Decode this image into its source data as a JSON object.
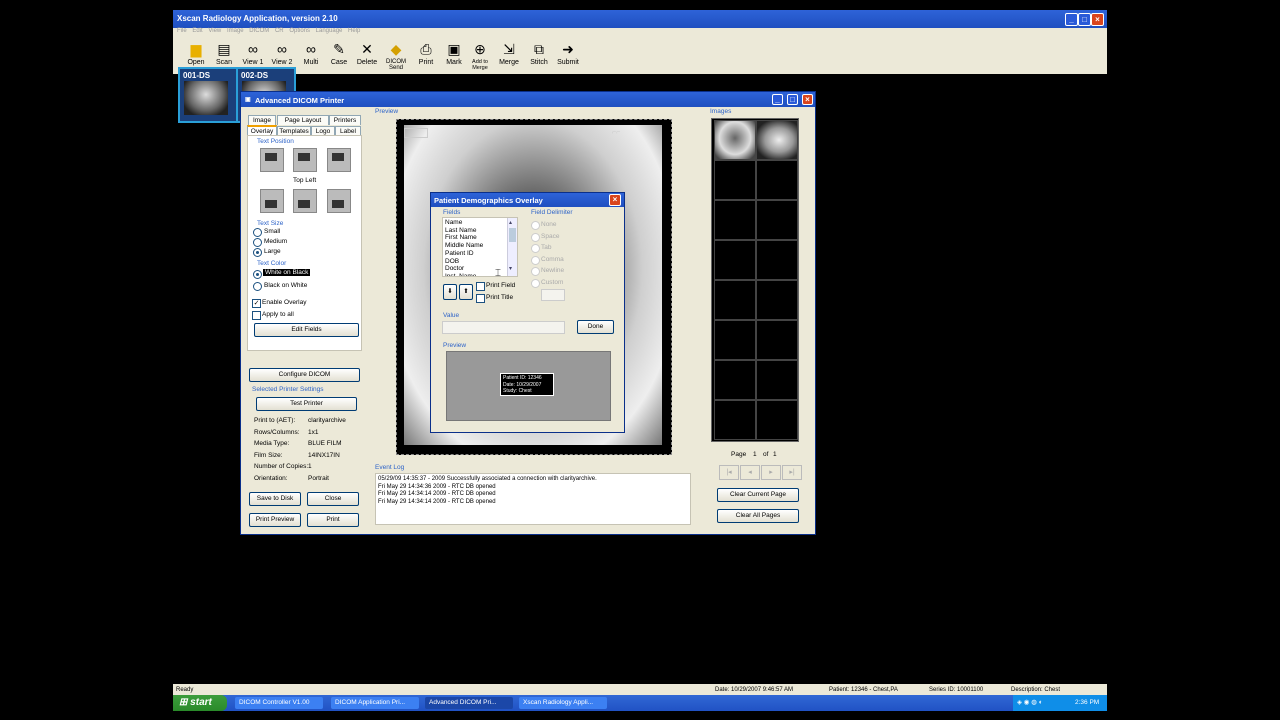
{
  "app": {
    "title": "Xscan Radiology Application, version 2.10",
    "menu": [
      "File",
      "Edit",
      "View",
      "Image",
      "DICOM",
      "CR",
      "Options",
      "Language",
      "Help"
    ],
    "toolbar": [
      "Open",
      "Scan",
      "View 1",
      "View 2",
      "Multi",
      "Case",
      "Delete",
      "DICOM Send",
      "Print",
      "Mark",
      "Add to Merge",
      "Merge",
      "Stitch",
      "Submit"
    ],
    "thumbs": [
      "001-DS",
      "002-DS"
    ]
  },
  "dialog": {
    "title": "Advanced DICOM Printer",
    "tabs_row1": [
      "Image",
      "Page Layout",
      "Printers"
    ],
    "tabs_row2": [
      "Overlay",
      "Templates",
      "Logo",
      "Label"
    ],
    "text_position_label": "Text Position",
    "text_position_value": "Top Left",
    "text_size_label": "Text Size",
    "text_size_options": [
      "Small",
      "Medium",
      "Large"
    ],
    "text_color_label": "Text Color",
    "text_color_options": [
      "White on Black",
      "Black on White"
    ],
    "enable_overlay": "Enable Overlay",
    "apply_to_all": "Apply to all",
    "edit_fields": "Edit Fields",
    "configure_dicom": "Configure DICOM",
    "selected_printer_settings": "Selected Printer Settings",
    "test_printer": "Test Printer",
    "printer_info": [
      {
        "k": "Print to (AET):",
        "v": "clarityarchive"
      },
      {
        "k": "Rows/Columns:",
        "v": "1x1"
      },
      {
        "k": "Media Type:",
        "v": "BLUE FILM"
      },
      {
        "k": "Film Size:",
        "v": "14INX17IN"
      },
      {
        "k": "Number of Copies:",
        "v": "1"
      },
      {
        "k": "Orientation:",
        "v": "Portrait"
      }
    ],
    "save_to_disk": "Save to Disk",
    "close": "Close",
    "print_preview": "Print Preview",
    "print": "Print",
    "preview_label": "Preview",
    "images_label": "Images",
    "page_label": "Page",
    "page_num": "1",
    "page_of": "of",
    "page_total": "1",
    "clear_current_page": "Clear Current Page",
    "clear_all_pages": "Clear All Pages",
    "event_log_label": "Event Log",
    "event_log": [
      "05/29/09 14:35:37 - 2009  Successfully associated a connection with clarityarchive.",
      "Fri May 29 14:34:36 2009 -   RTC DB opened",
      "Fri May 29 14:34:14 2009 -   RTC DB opened",
      "Fri May 29 14:34:14 2009 -   RTC DB opened"
    ]
  },
  "overlay": {
    "title": "Patient Demographics Overlay",
    "fields_label": "Fields",
    "fields": [
      "Name",
      "Last Name",
      "First Name",
      "Middle Name",
      "Patient ID",
      "DOB",
      "Doctor",
      "Inst. Name"
    ],
    "field_delimiter_label": "Field Delimiter",
    "delimiters": [
      "None",
      "Space",
      "Tab",
      "Comma",
      "Newline",
      "Custom"
    ],
    "print_field": "Print Field",
    "print_title": "Print Title",
    "value_label": "Value",
    "done": "Done",
    "preview_label": "Preview",
    "preview_lines": [
      "Patient ID:  12346",
      "Date:  10/29/2007",
      "Study:  Chest"
    ]
  },
  "status": {
    "ready": "Ready",
    "date": "Date: 10/29/2007 9:46:57 AM",
    "patient": "Patient: 12346 - Chest,PA",
    "series": "Series ID: 10001100",
    "description": "Description: Chest"
  },
  "taskbar": {
    "start": "start",
    "tasks": [
      "DICOM Controller V1.00",
      "DICOM Application Pri...",
      "Advanced DICOM Pri...",
      "Xscan Radiology Appli..."
    ],
    "clock": "2:36 PM"
  },
  "colors": {
    "accent": "#2d63c8",
    "title": "#1f4fc0",
    "taskbar": "#2152c4"
  }
}
